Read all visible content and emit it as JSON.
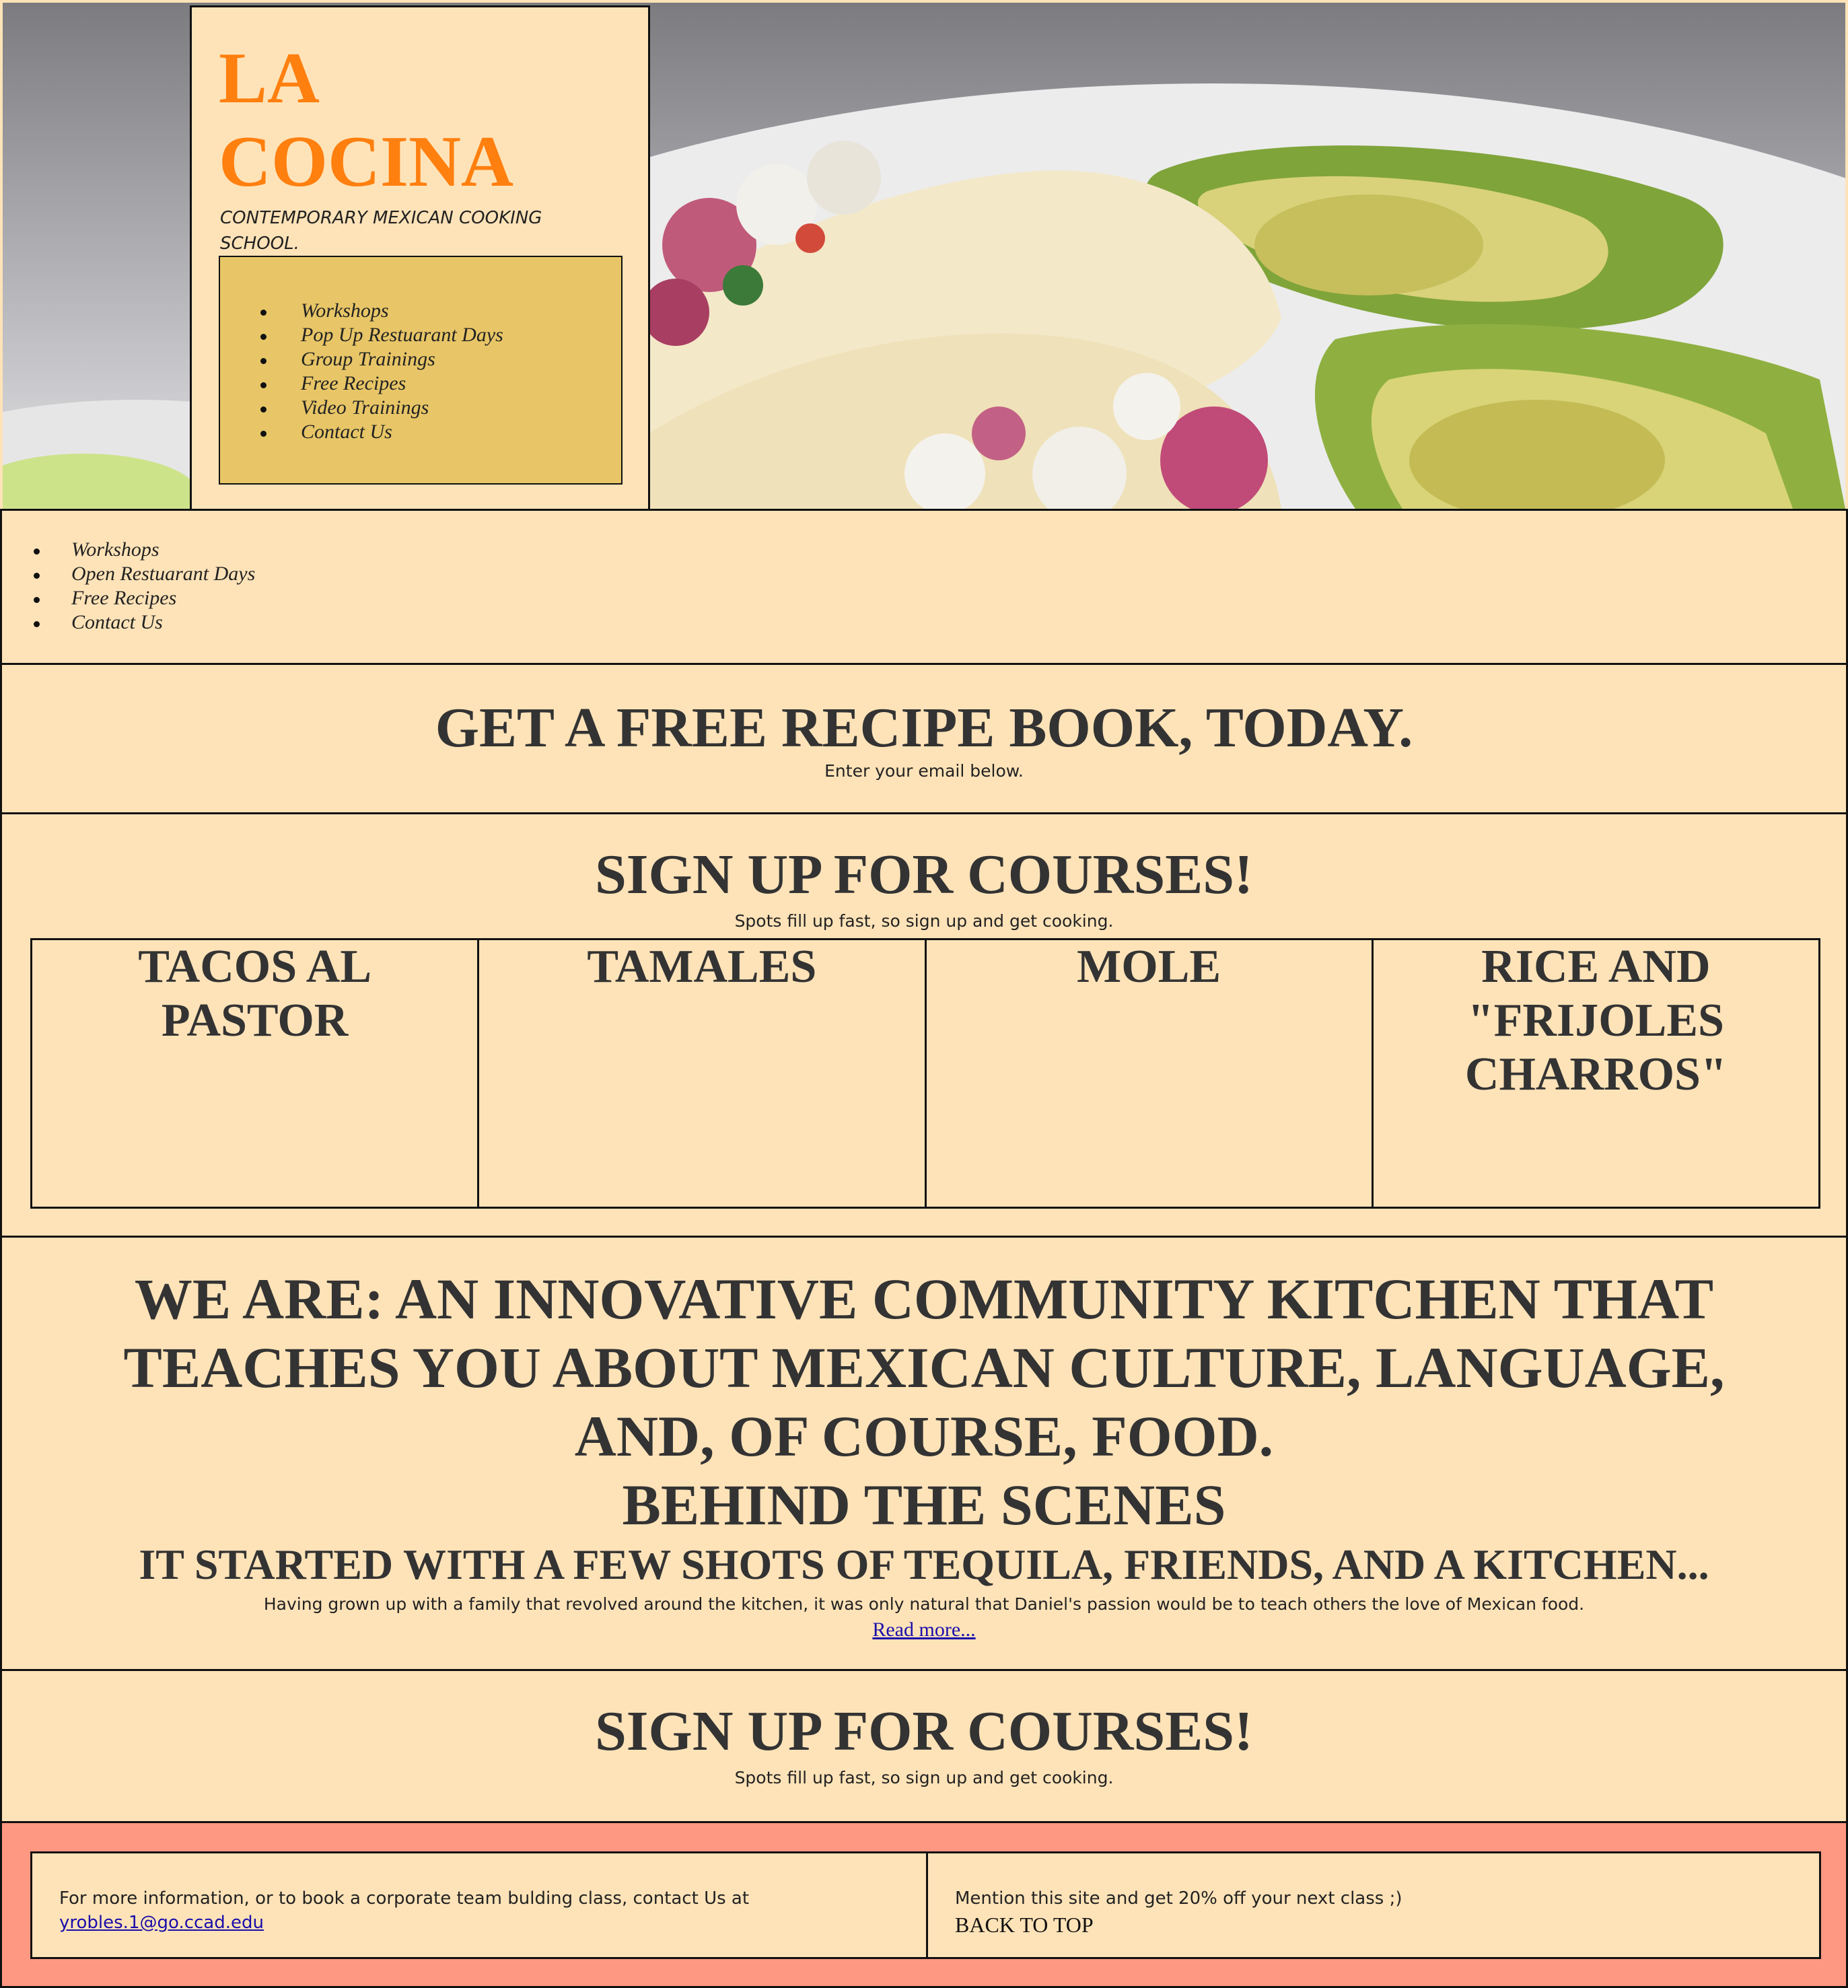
{
  "brand": {
    "title_line1": "LA",
    "title_line2": "COCINA",
    "tagline": "CONTEMPORARY MEXICAN COOKING SCHOOL.",
    "title_color": "#ff7f0f"
  },
  "hero_nav": {
    "items": [
      "Workshops",
      "Pop Up Restuarant Days",
      "Group Trainings",
      "Free Recipes",
      "Video Trainings",
      "Contact Us"
    ]
  },
  "secondary_nav": {
    "items": [
      "Workshops",
      "Open Restuarant Days",
      "Free Recipes",
      "Contact Us"
    ]
  },
  "free_recipe": {
    "heading": "GET A FREE RECIPE BOOK, TODAY.",
    "subtext": "Enter your email below."
  },
  "courses": {
    "heading": "SIGN UP FOR COURSES!",
    "subtext": "Spots fill up fast, so sign up and get cooking.",
    "items": [
      "TACOS AL PASTOR",
      "TAMALES",
      "MOLE",
      "RICE AND \"FRIJOLES CHARROS\""
    ]
  },
  "about": {
    "headline": "WE ARE: AN INNOVATIVE COMMUNITY KITCHEN THAT TEACHES YOU ABOUT MEXICAN CULTURE, LANGUAGE, AND, OF COURSE, FOOD.",
    "headline_lines": [
      "WE ARE: AN INNOVATIVE COMMUNITY KITCHEN THAT",
      "TEACHES YOU ABOUT MEXICAN CULTURE, LANGUAGE,",
      "AND, OF COURSE, FOOD."
    ],
    "behind_heading": "BEHIND THE SCENES",
    "story_heading": "IT STARTED WITH A FEW SHOTS OF TEQUILA, FRIENDS, AND A KITCHEN...",
    "story_text": "Having grown up with a family that revolved around the kitchen, it was only natural that Daniel's passion would be to teach others the love of Mexican food.",
    "read_more": "Read more..."
  },
  "courses_repeat": {
    "heading": "SIGN UP FOR COURSES!",
    "subtext": "Spots fill up fast, so sign up and get cooking."
  },
  "footer": {
    "contact_text": "For more information, or to book a corporate team bulding class, contact Us at",
    "email": "yrobles.1@go.ccad.edu",
    "promo_text": "Mention this site and get 20% off your next class ;)",
    "back_to_top": "BACK TO TOP",
    "background_color": "#ff9882"
  },
  "colors": {
    "page_background": "#ffe3b8",
    "nav_box": "#e8c667",
    "link": "#1a0dab",
    "heading_text": "#333333"
  }
}
